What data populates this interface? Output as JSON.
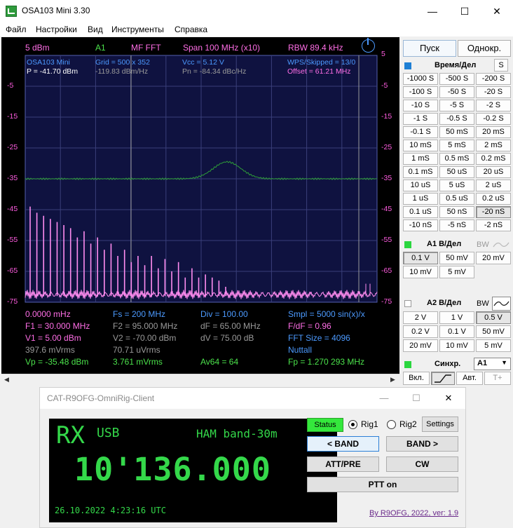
{
  "window": {
    "title": "OSA103 Mini 3.30",
    "minimize": "—",
    "maximize": "☐",
    "close": "✕"
  },
  "menu": [
    "Файл",
    "Настройки",
    "Вид",
    "Инструменты",
    "Справка"
  ],
  "plot": {
    "header": {
      "ref_level": "5 dBm",
      "channel": "A1",
      "mode": "MF FFT",
      "span": "Span 100 MHz (x10)",
      "rbw": "RBW 89.4 kHz"
    },
    "info_left": {
      "name": "OSA103 Mini",
      "p": "P = -41.70 dBm",
      "grid": "Grid = 500 x 352",
      "density": "-119.83 dBm/Hz",
      "vcc": "Vcc = 5.12 V",
      "pn": "Pn = -84.34 dBc/Hz",
      "wps": "WPS/Skipped = 13/0",
      "offset": "Offset = 61.21 MHz"
    },
    "y_labels": [
      "5",
      "-5",
      "-15",
      "-25",
      "-35",
      "-45",
      "-55",
      "-65",
      "-75"
    ],
    "measurements": {
      "freq": "0.0000 mHz",
      "fs": "Fs = 200 MHz",
      "div": "Div = 100.00",
      "smpl": "Smpl = 5000 sin(x)/x",
      "f1": "F1 = 30.000 MHz",
      "f2": "F2 = 95.000 MHz",
      "df": "dF = 65.00 MHz",
      "fdf": "F/dF = 0.96",
      "v1": "V1 = 5.00 dBm",
      "v2": "V2 = -70.00 dBm",
      "dv": "dV = 75.00 dB",
      "fft_size": "FFT Size = 4096",
      "mvrms": "397.6 mVrms",
      "uvrms": "70.71 uVrms",
      "window": "Nuttall",
      "vp": "Vp = -35.48 dBm",
      "vrms": "3.761 mVrms",
      "av": "Av64 = 64",
      "fp": "Fp = 1.270 293 MHz"
    },
    "colors": {
      "background": "#000000",
      "plot_area": "#0f1240",
      "trace": "#ff8cf0",
      "noise_trace": "#2e9e38",
      "grid": "#3a3f7a",
      "axis_labels": "#ff5ce0",
      "header_green": "#4be14b",
      "header_pink": "#ff6ee6",
      "info_blue": "#4c9aff",
      "info_gray": "#9a9a9a"
    },
    "chart_data": {
      "type": "line",
      "ylim": [
        -75,
        5
      ],
      "grid": true,
      "series": [
        {
          "values": [
            -44,
            -46,
            -47,
            -48,
            -49,
            -50,
            -51,
            -54,
            -52,
            -56,
            -54,
            -58,
            -56,
            -60,
            -58,
            -62,
            -60,
            -63,
            -60,
            -64,
            -61,
            -65,
            -62,
            -67,
            -64,
            -67,
            -66,
            -67,
            -68,
            -70
          ]
        },
        {
          "baseline": -35,
          "bump_peak": -29.5
        }
      ]
    }
  },
  "panel": {
    "start": "Пуск",
    "single": "Однокр.",
    "time_div": "Время/Дел",
    "s_btn": "S",
    "time_buttons": [
      [
        "-1000 S",
        "-500 S",
        "-200 S"
      ],
      [
        "-100 S",
        "-50 S",
        "-20 S"
      ],
      [
        "-10 S",
        "-5 S",
        "-2 S"
      ],
      [
        "-1 S",
        "-0.5 S",
        "-0.2 S"
      ],
      [
        "-0.1 S",
        "50 mS",
        "20 mS"
      ],
      [
        "10 mS",
        "5 mS",
        "2 mS"
      ],
      [
        "1 mS",
        "0.5 mS",
        "0.2 mS"
      ],
      [
        "0.1 mS",
        "50 uS",
        "20 uS"
      ],
      [
        "10 uS",
        "5 uS",
        "2 uS"
      ],
      [
        "1 uS",
        "0.5 uS",
        "0.2 uS"
      ],
      [
        "0.1 uS",
        "50 nS",
        "-20 nS"
      ],
      [
        "-10 nS",
        "-5 nS",
        "-2 nS"
      ]
    ],
    "a1_label": "A1 В/Дел",
    "bw": "BW",
    "a1_buttons": [
      [
        "0.1 V",
        "50 mV",
        "20 mV"
      ],
      [
        "10 mV",
        "5 mV"
      ]
    ],
    "a2_label": "A2 В/Дел",
    "a2_buttons": [
      [
        "2 V",
        "1 V",
        "0.5 V"
      ],
      [
        "0.2 V",
        "0.1 V",
        "50 mV"
      ],
      [
        "20 mV",
        "10 mV",
        "5 mV"
      ]
    ],
    "sync_label": "Синхр.",
    "sync_value": "A1",
    "on": "Вкл.",
    "auto": "Авт.",
    "tplus": "T+"
  },
  "cat": {
    "title": "CAT-R9OFG-OmniRig-Client",
    "mode": "RX",
    "modulation": "USB",
    "band": "HAM band-30m",
    "frequency": "10'136.000",
    "datetime": "26.10.2022  4:23:16 UTC",
    "status": "Status",
    "rig1": "Rig1",
    "rig2": "Rig2",
    "settings": "Settings",
    "band_down": "< BAND",
    "band_up": "BAND >",
    "att_pre": "ATT/PRE",
    "cw": "CW",
    "ptt": "PTT on",
    "credit": "By R9OFG, 2022, ver: 1.9"
  }
}
